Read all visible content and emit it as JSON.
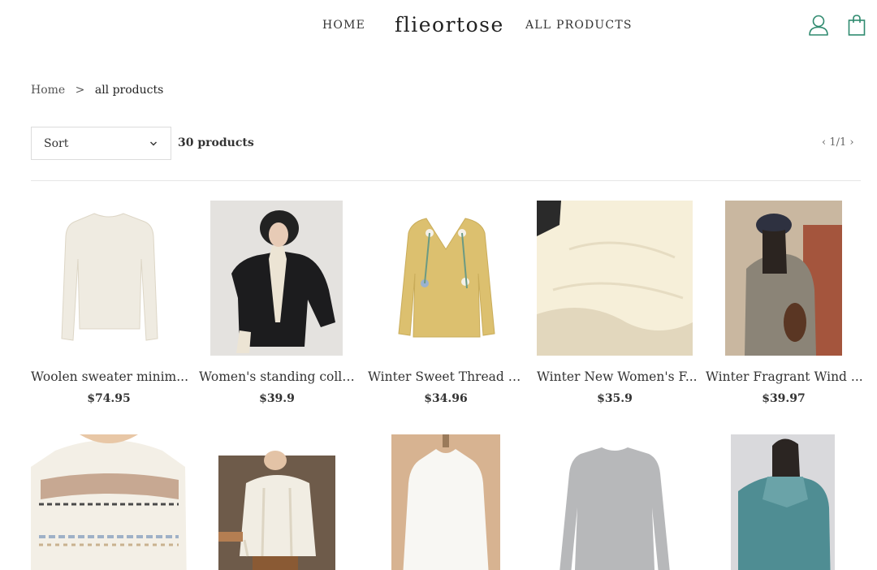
{
  "header": {
    "nav_home": "HOME",
    "brand": "flieortose",
    "nav_all_products": "ALL PRODUCTS",
    "user_icon": "user-icon",
    "bag_icon": "shopping-bag-icon",
    "accent_color": "#2f8a6f"
  },
  "breadcrumb": {
    "home": "Home",
    "separator": ">",
    "current": "all products"
  },
  "toolbar": {
    "sort_label": "Sort",
    "product_count": "30 products",
    "pagination": "1/1"
  },
  "products": [
    {
      "title": "Woolen sweater minim...",
      "price": "$74.95"
    },
    {
      "title": "Women's standing colla...",
      "price": "$39.9"
    },
    {
      "title": "Winter Sweet Thread H...",
      "price": "$34.96"
    },
    {
      "title": "Winter New Women's F...",
      "price": "$35.9"
    },
    {
      "title": "Winter Fragrant Wind ...",
      "price": "$39.97"
    },
    {
      "title": "",
      "price": ""
    },
    {
      "title": "",
      "price": ""
    },
    {
      "title": "",
      "price": ""
    },
    {
      "title": "",
      "price": ""
    },
    {
      "title": "",
      "price": ""
    }
  ]
}
